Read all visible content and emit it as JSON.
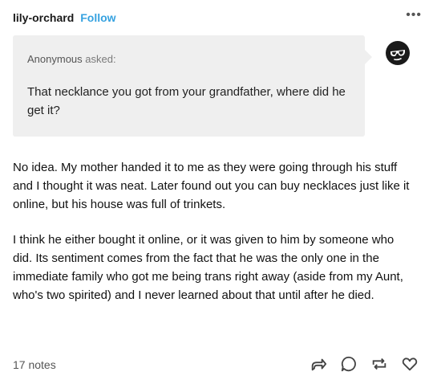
{
  "post": {
    "username": "lily-orchard",
    "follow_label": "Follow",
    "more_label": "•••",
    "ask": {
      "asker": "Anonymous",
      "asked_label": "asked:",
      "question": "That necklance you got from your grandfather, where did he get it?"
    },
    "answer": [
      "No idea. My mother handed it to me as they were going through his stuff and I thought it was neat. Later found out you can buy necklaces just like it online, but his house was full of trinkets.",
      "I think he either bought it online, or it was given to him by someone who did. Its sentiment comes from the fact that he was the only one in the immediate family who got me being trans right away (aside from my Aunt, who's two spirited) and I never learned about that until after he died."
    ],
    "notes": "17 notes"
  },
  "icons": {
    "more": "more-options-icon",
    "avatar": "sunglasses-avatar-icon",
    "share": "share-icon",
    "reply": "reply-icon",
    "reblog": "reblog-icon",
    "like": "heart-icon"
  },
  "colors": {
    "follow": "#36a2e0",
    "ask_background": "#efefef",
    "text": "#111111"
  }
}
